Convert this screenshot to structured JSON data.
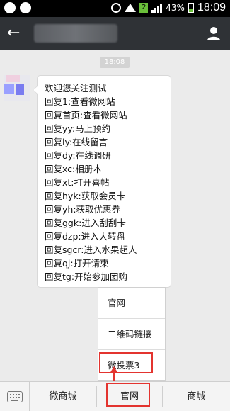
{
  "status_bar": {
    "battery": "43%",
    "sim": "2",
    "time": "18:09"
  },
  "title_bar": {
    "back_icon": "back-arrow-icon",
    "profile_icon": "profile-icon"
  },
  "chat": {
    "timestamp": "18:08",
    "message_lines": [
      "欢迎您关注测试",
      "回复1:查看微网站",
      "回复首页:查看微网站",
      "回复yy:马上预约",
      "回复ly:在线留言",
      "回复dy:在线调研",
      "回复xc:相册本",
      "回复xt:打开喜帖",
      "回复hyk:获取会员卡",
      "回复yh:获取优惠券",
      "回复ggk:进入刮刮卡",
      "回复dzp:进入大转盘",
      "回复sgcr:进入水果超人",
      "回复qj:打开请柬",
      "回复tg:开始参加团购"
    ]
  },
  "popup_menu": {
    "items": [
      "官网",
      "二维码链接",
      "微投票3"
    ]
  },
  "bottom_nav": {
    "keyboard_icon": "keyboard-icon",
    "items": [
      "微商城",
      "官网",
      "商城"
    ]
  },
  "colors": {
    "highlight": "#e3342f",
    "title_bar_bg": "#2f3236",
    "chat_bg": "#ebebeb"
  }
}
